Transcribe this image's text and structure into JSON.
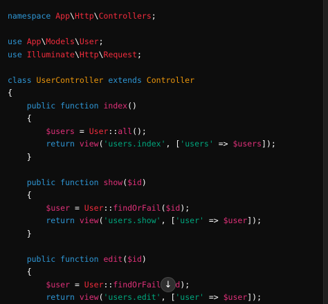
{
  "code_lines": [
    {
      "tokens": [
        {
          "t": "namespace ",
          "c": "kw"
        },
        {
          "t": "App",
          "c": "cls"
        },
        {
          "t": "\\",
          "c": "pl"
        },
        {
          "t": "Http",
          "c": "cls"
        },
        {
          "t": "\\",
          "c": "pl"
        },
        {
          "t": "Controllers",
          "c": "cls"
        },
        {
          "t": ";",
          "c": "pl"
        }
      ]
    },
    {
      "tokens": []
    },
    {
      "tokens": [
        {
          "t": "use ",
          "c": "kw"
        },
        {
          "t": "App",
          "c": "cls"
        },
        {
          "t": "\\",
          "c": "pl"
        },
        {
          "t": "Models",
          "c": "cls"
        },
        {
          "t": "\\",
          "c": "pl"
        },
        {
          "t": "User",
          "c": "cls"
        },
        {
          "t": ";",
          "c": "pl"
        }
      ]
    },
    {
      "tokens": [
        {
          "t": "use ",
          "c": "kw"
        },
        {
          "t": "Illuminate",
          "c": "cls"
        },
        {
          "t": "\\",
          "c": "pl"
        },
        {
          "t": "Http",
          "c": "cls"
        },
        {
          "t": "\\",
          "c": "pl"
        },
        {
          "t": "Request",
          "c": "cls"
        },
        {
          "t": ";",
          "c": "pl"
        }
      ]
    },
    {
      "tokens": []
    },
    {
      "tokens": [
        {
          "t": "class ",
          "c": "kw"
        },
        {
          "t": "UserController",
          "c": "acc"
        },
        {
          "t": " extends ",
          "c": "kw"
        },
        {
          "t": "Controller",
          "c": "acc"
        }
      ]
    },
    {
      "tokens": [
        {
          "t": "{",
          "c": "pl"
        }
      ]
    },
    {
      "tokens": [
        {
          "t": "    public function ",
          "c": "kw"
        },
        {
          "t": "index",
          "c": "fn"
        },
        {
          "t": "()",
          "c": "pl"
        }
      ]
    },
    {
      "tokens": [
        {
          "t": "    {",
          "c": "pl"
        }
      ]
    },
    {
      "tokens": [
        {
          "t": "        ",
          "c": "pl"
        },
        {
          "t": "$users",
          "c": "var"
        },
        {
          "t": " = ",
          "c": "pl"
        },
        {
          "t": "User",
          "c": "cls"
        },
        {
          "t": "::",
          "c": "pl"
        },
        {
          "t": "all",
          "c": "fn"
        },
        {
          "t": "();",
          "c": "pl"
        }
      ]
    },
    {
      "tokens": [
        {
          "t": "        return ",
          "c": "kw"
        },
        {
          "t": "view",
          "c": "fn"
        },
        {
          "t": "(",
          "c": "pl"
        },
        {
          "t": "'users.index'",
          "c": "str"
        },
        {
          "t": ", [",
          "c": "pl"
        },
        {
          "t": "'users'",
          "c": "str"
        },
        {
          "t": " => ",
          "c": "pl"
        },
        {
          "t": "$users",
          "c": "var"
        },
        {
          "t": "]);",
          "c": "pl"
        }
      ]
    },
    {
      "tokens": [
        {
          "t": "    }",
          "c": "pl"
        }
      ]
    },
    {
      "tokens": []
    },
    {
      "tokens": [
        {
          "t": "    public function ",
          "c": "kw"
        },
        {
          "t": "show",
          "c": "fn"
        },
        {
          "t": "(",
          "c": "pl"
        },
        {
          "t": "$id",
          "c": "var"
        },
        {
          "t": ")",
          "c": "pl"
        }
      ]
    },
    {
      "tokens": [
        {
          "t": "    {",
          "c": "pl"
        }
      ]
    },
    {
      "tokens": [
        {
          "t": "        ",
          "c": "pl"
        },
        {
          "t": "$user",
          "c": "var"
        },
        {
          "t": " = ",
          "c": "pl"
        },
        {
          "t": "User",
          "c": "cls"
        },
        {
          "t": "::",
          "c": "pl"
        },
        {
          "t": "findOrFail",
          "c": "fn"
        },
        {
          "t": "(",
          "c": "pl"
        },
        {
          "t": "$id",
          "c": "var"
        },
        {
          "t": ");",
          "c": "pl"
        }
      ]
    },
    {
      "tokens": [
        {
          "t": "        return ",
          "c": "kw"
        },
        {
          "t": "view",
          "c": "fn"
        },
        {
          "t": "(",
          "c": "pl"
        },
        {
          "t": "'users.show'",
          "c": "str"
        },
        {
          "t": ", [",
          "c": "pl"
        },
        {
          "t": "'user'",
          "c": "str"
        },
        {
          "t": " => ",
          "c": "pl"
        },
        {
          "t": "$user",
          "c": "var"
        },
        {
          "t": "]);",
          "c": "pl"
        }
      ]
    },
    {
      "tokens": [
        {
          "t": "    }",
          "c": "pl"
        }
      ]
    },
    {
      "tokens": []
    },
    {
      "tokens": [
        {
          "t": "    public function ",
          "c": "kw"
        },
        {
          "t": "edit",
          "c": "fn"
        },
        {
          "t": "(",
          "c": "pl"
        },
        {
          "t": "$id",
          "c": "var"
        },
        {
          "t": ")",
          "c": "pl"
        }
      ]
    },
    {
      "tokens": [
        {
          "t": "    {",
          "c": "pl"
        }
      ]
    },
    {
      "tokens": [
        {
          "t": "        ",
          "c": "pl"
        },
        {
          "t": "$user",
          "c": "var"
        },
        {
          "t": " = ",
          "c": "pl"
        },
        {
          "t": "User",
          "c": "cls"
        },
        {
          "t": "::",
          "c": "pl"
        },
        {
          "t": "findOrFail",
          "c": "fn"
        },
        {
          "t": "(",
          "c": "pl"
        },
        {
          "t": "$id",
          "c": "var"
        },
        {
          "t": ");",
          "c": "pl"
        }
      ]
    },
    {
      "tokens": [
        {
          "t": "        return ",
          "c": "kw"
        },
        {
          "t": "view",
          "c": "fn"
        },
        {
          "t": "(",
          "c": "pl"
        },
        {
          "t": "'users.edit'",
          "c": "str"
        },
        {
          "t": ", [",
          "c": "pl"
        },
        {
          "t": "'user'",
          "c": "str"
        },
        {
          "t": " => ",
          "c": "pl"
        },
        {
          "t": "$user",
          "c": "var"
        },
        {
          "t": "]);",
          "c": "pl"
        }
      ]
    }
  ],
  "scroll_button": {
    "icon": "arrow-down-icon",
    "glyph": "↓"
  },
  "colors": {
    "background": "#0d0d0d",
    "keyword": "#2e95d3",
    "class_name": "#f22c3d",
    "function": "#df3079",
    "string": "#00a67d",
    "variable": "#df3079",
    "accent": "#e9950c",
    "plain": "#ffffff"
  }
}
